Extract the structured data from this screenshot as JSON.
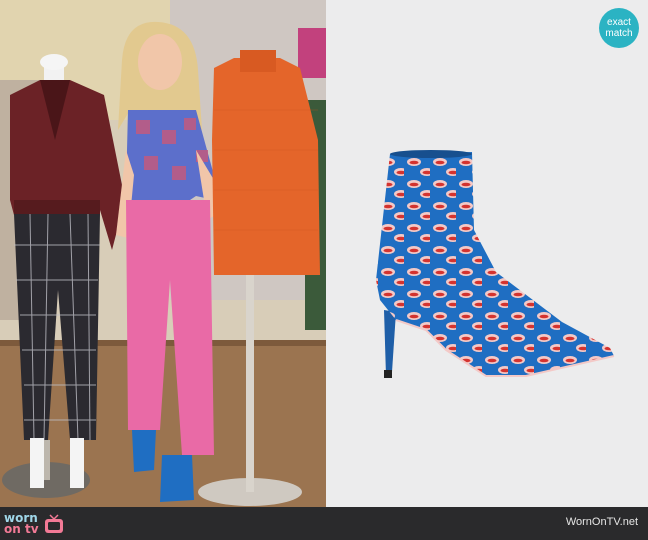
{
  "badge": {
    "line1": "exact",
    "line2": "match"
  },
  "footer": {
    "logo": {
      "word1": "worn",
      "word2": "on tv"
    },
    "site": "WornOnTV.net"
  },
  "watermark": "wornontv.net",
  "colors": {
    "badge": "#2bb3c3",
    "footer": "#2a2a2c",
    "boot_blue": "#1f6ec2",
    "pants_pink": "#e96aa6",
    "sweater_orange": "#e4652a",
    "jacket_burgundy": "#6b2226",
    "background_gray": "#ececed"
  }
}
